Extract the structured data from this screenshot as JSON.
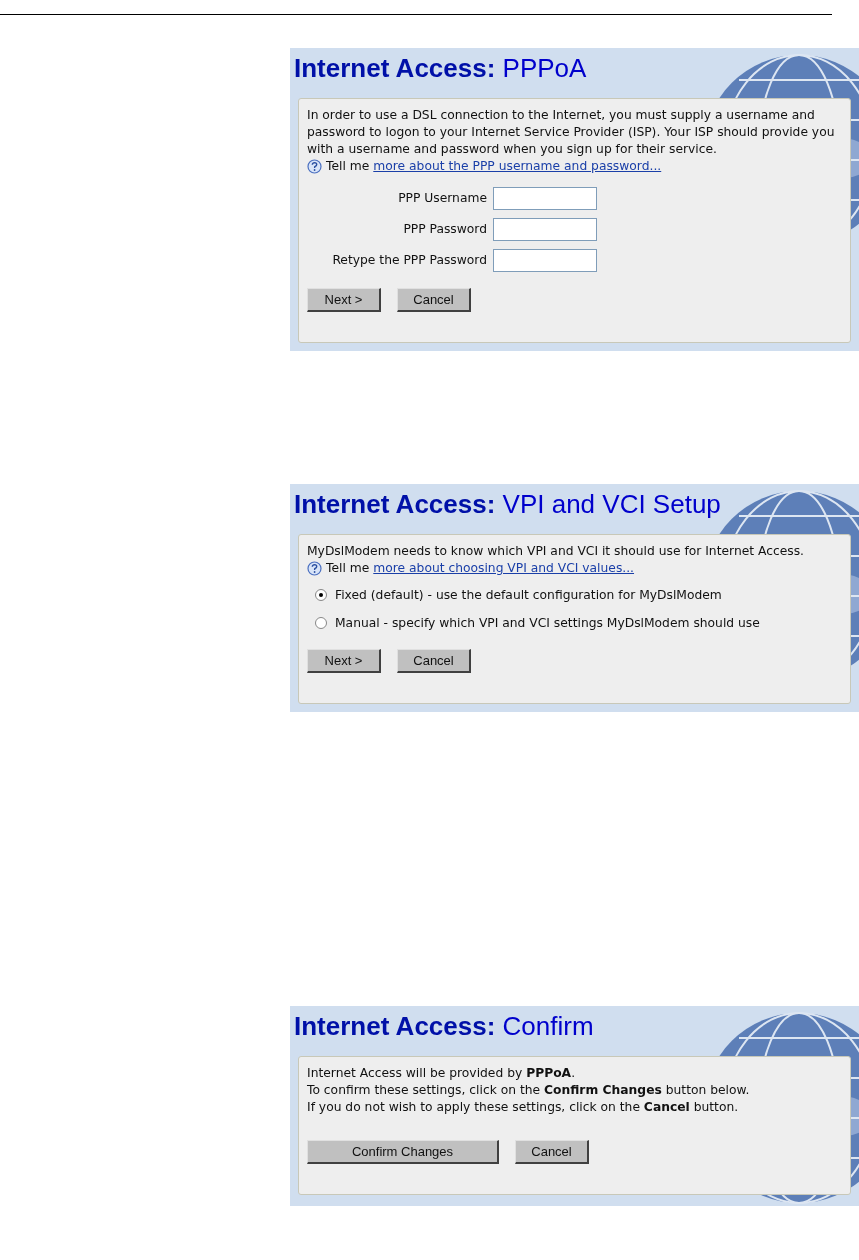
{
  "panels": [
    {
      "title_prefix": "Internet Access:",
      "title": "PPPoA",
      "paragraphs": [
        "In order to use a DSL connection to the Internet, you must supply a username and password to logon to your Internet Service Provider (ISP). Your ISP should provide you with a username and password when you sign up for their service."
      ],
      "help": {
        "prefix": "Tell me",
        "link": "more about the PPP username and password..."
      },
      "fields": [
        {
          "label": "PPP Username"
        },
        {
          "label": "PPP Password"
        },
        {
          "label": "Retype the PPP Password"
        }
      ],
      "buttons": [
        "Next >",
        "Cancel"
      ]
    },
    {
      "title_prefix": "Internet Access:",
      "title": "VPI and VCI Setup",
      "paragraphs": [
        "MyDslModem needs to know which VPI and VCI it should use for Internet Access."
      ],
      "help": {
        "prefix": "Tell me",
        "link": "more about choosing VPI and VCI values..."
      },
      "options": [
        {
          "label": "Fixed (default) - use the default configuration for MyDslModem",
          "selected": true
        },
        {
          "label": "Manual - specify which VPI and VCI settings MyDslModem should use",
          "selected": false
        }
      ],
      "buttons": [
        "Next >",
        "Cancel"
      ]
    },
    {
      "title_prefix": "Internet Access:",
      "title": "Confirm",
      "paragraphs": [
        "Internet Access will be provided by **PPPoA**.",
        "To confirm these settings, click on the **Confirm Changes** button below.",
        "If you do not wish to apply these settings, click on the **Cancel** button."
      ],
      "buttons": [
        "Confirm Changes",
        "Cancel"
      ]
    }
  ]
}
